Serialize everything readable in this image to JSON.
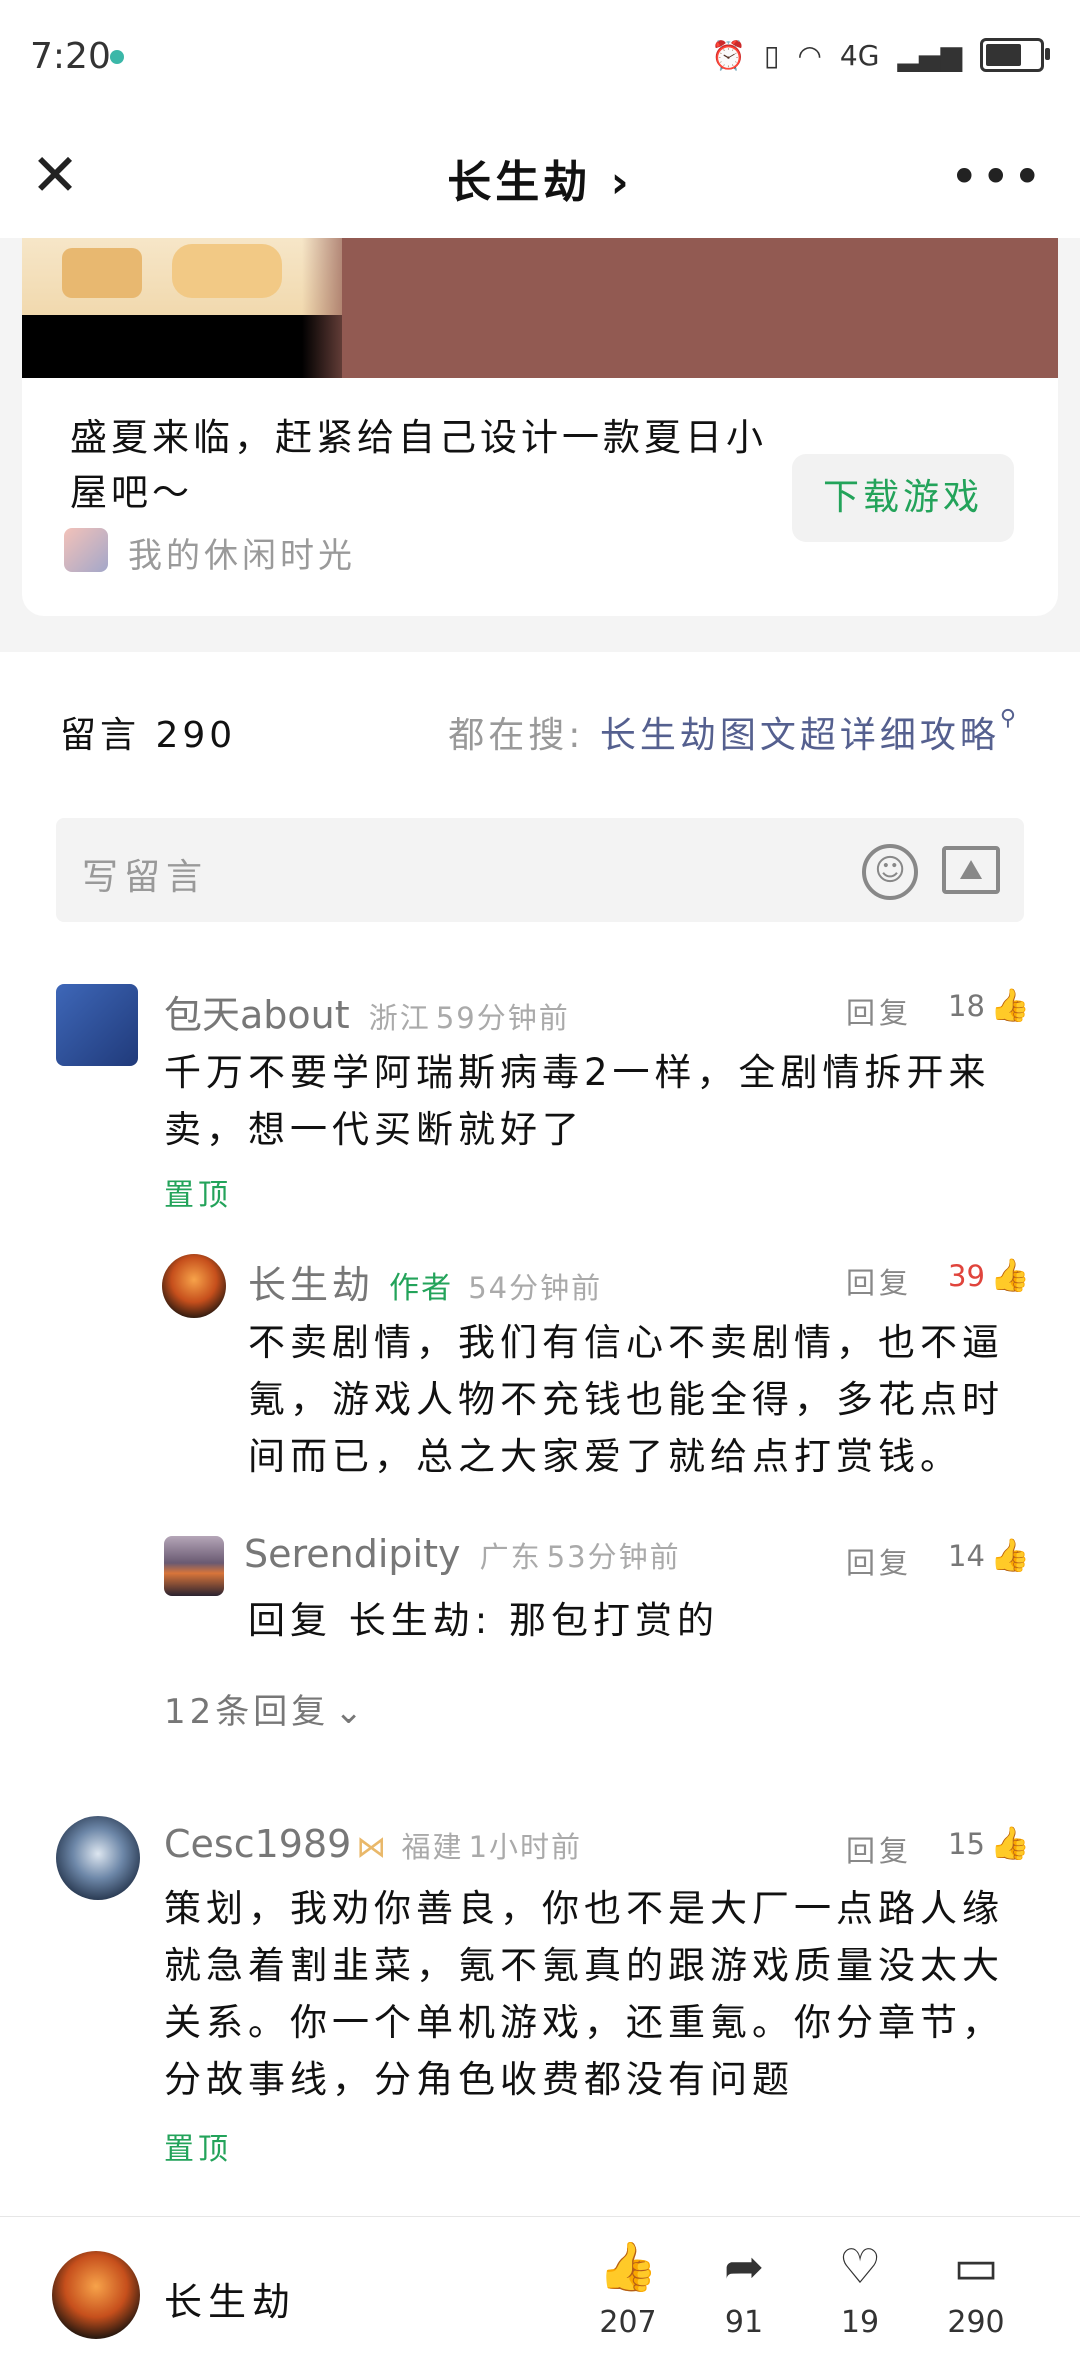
{
  "status": {
    "time": "7:20",
    "network": "4G"
  },
  "nav": {
    "title": "长生劫 ›",
    "close": "✕",
    "more": "•••"
  },
  "card": {
    "text": "盛夏来临，赶紧给自己设计一款夏日小屋吧～",
    "account": "我的休闲时光",
    "download_label": "下载游戏"
  },
  "comments_header": {
    "title": "留言 290",
    "search_prefix": "都在搜:",
    "search_link": "长生劫图文超详细攻略",
    "write_placeholder": "写留言"
  },
  "comments": [
    {
      "user": "包天about",
      "location": "浙江",
      "time": "59分钟前",
      "reply": "回复",
      "likes": "18",
      "text": "千万不要学阿瑞斯病毒2一样，全剧情拆开来卖，想一代买断就好了",
      "pinned": "置顶",
      "replies": [
        {
          "user": "长生劫",
          "tag": "作者",
          "time": "54分钟前",
          "reply": "回复",
          "likes": "39",
          "text": "不卖剧情，我们有信心不卖剧情，也不逼氪，游戏人物不充钱也能全得，多花点时间而已，总之大家爱了就给点打赏钱。"
        },
        {
          "user": "Serendipity",
          "location": "广东",
          "time": "53分钟前",
          "reply": "回复",
          "likes": "14",
          "text": "回复 长生劫: 那包打赏的"
        }
      ],
      "more_replies": "12条回复"
    },
    {
      "user": "Cesc1989",
      "location": "福建",
      "time": "1小时前",
      "reply": "回复",
      "likes": "15",
      "text": "策划，我劝你善良，你也不是大厂一点路人缘就急着割韭菜，氪不氪真的跟游戏质量没太大关系。你一个单机游戏，还重氪。你分章节，分故事线，分角色收费都没有问题",
      "pinned": "置顶"
    }
  ],
  "bottom_bar": {
    "name": "长生劫",
    "like_count": "207",
    "share_count": "91",
    "fav_count": "19",
    "comment_count": "290"
  },
  "colors": {
    "accent_green": "#23a35a",
    "hot_red": "#e0443c",
    "link_blue": "#55608f",
    "banner_brown": "#925a52"
  }
}
